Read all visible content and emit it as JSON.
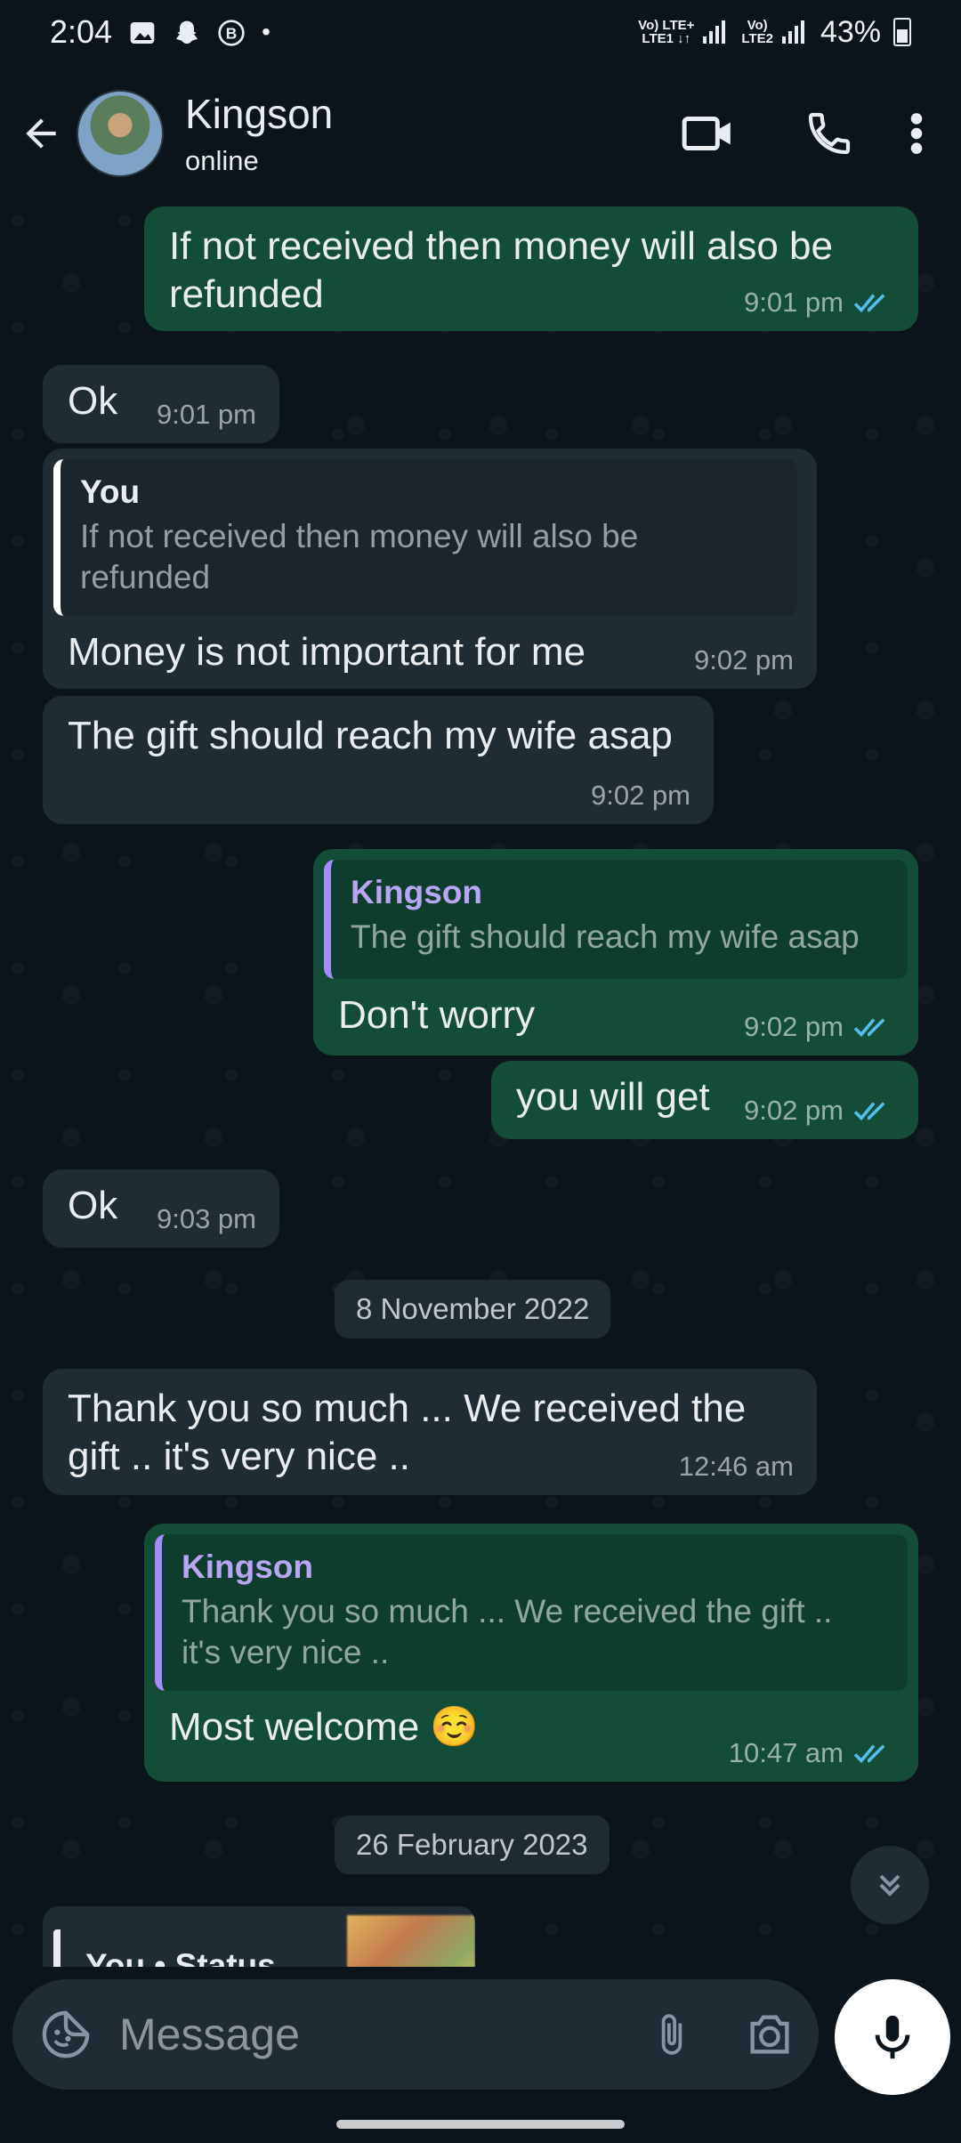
{
  "status_bar": {
    "time": "2:04",
    "sim1": "Vo) LTE+ LTE1",
    "sim1_top": "Vo) LTE+",
    "sim1_bottom": "LTE1 ↓↑",
    "sim2_top": "Vo)",
    "sim2_bottom": "LTE2",
    "battery": "43%"
  },
  "header": {
    "contact_name": "Kingson",
    "presence": "online",
    "icons": [
      "back-arrow-icon",
      "video-call-icon",
      "voice-call-icon",
      "more-vert-icon"
    ]
  },
  "messages": [
    {
      "dir": "out",
      "text": "If not received then money will also be refunded",
      "time": "9:01 pm",
      "read": true
    },
    {
      "dir": "in",
      "text": "Ok",
      "time": "9:01 pm"
    },
    {
      "dir": "in",
      "quote_author": "You",
      "quote_text": "If not received then money will also be refunded",
      "text": "Money is not important for me",
      "time": "9:02 pm"
    },
    {
      "dir": "in",
      "text": "The gift should reach my wife asap",
      "time": "9:02 pm"
    },
    {
      "dir": "out",
      "quote_author": "Kingson",
      "quote_text": "The gift should reach my wife asap",
      "text": "Don't worry",
      "time": "9:02 pm",
      "read": true
    },
    {
      "dir": "out",
      "text": "you will get",
      "time": "9:02 pm",
      "read": true
    },
    {
      "dir": "in",
      "text": "Ok",
      "time": "9:03 pm"
    },
    {
      "dir": "in",
      "text": "Thank you so much ... We received the gift .. it's very nice ..",
      "time": "12:46 am"
    },
    {
      "dir": "out",
      "quote_author": "Kingson",
      "quote_text": "Thank you so much ... We received the gift .. it's very nice ..",
      "text": "Most welcome ☺️",
      "time": "10:47 am",
      "read": true
    }
  ],
  "date_chips": [
    "8 November 2022",
    "26 February 2023"
  ],
  "status_reply": {
    "label": "You • Status"
  },
  "composer": {
    "placeholder": "Message"
  },
  "colors": {
    "outgoing": "#144d37",
    "incoming": "#202c33",
    "read_ticks": "#53bdeb",
    "quote_accent": "#a78bfa"
  }
}
